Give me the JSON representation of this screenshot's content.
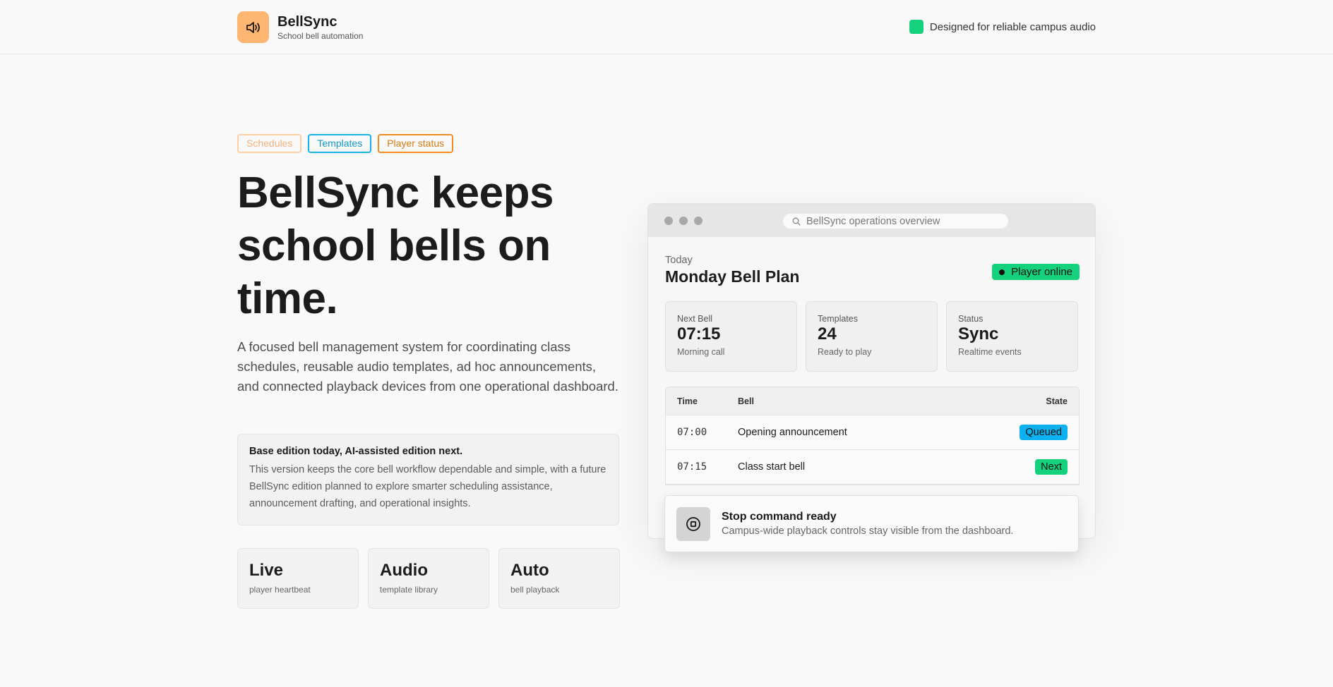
{
  "header": {
    "app_name": "BellSync",
    "app_subtitle": "School bell automation",
    "logo_icon": "speaker-icon",
    "tagline": "Designed for reliable campus audio"
  },
  "chips": [
    "Schedules",
    "Templates",
    "Player status"
  ],
  "hero": {
    "title": "BellSync keeps school bells on time.",
    "description": "A focused bell management system for coordinating class schedules, reusable audio templates, ad hoc announcements, and connected playback devices from one operational dashboard."
  },
  "note": {
    "title": "Base edition today, AI-assisted edition next.",
    "body": "This version keeps the core bell workflow dependable and simple, with a future BellSync edition planned to explore smarter scheduling assistance, announcement drafting, and operational insights."
  },
  "stats": [
    {
      "big": "Live",
      "small": "player heartbeat"
    },
    {
      "big": "Audio",
      "small": "template library"
    },
    {
      "big": "Auto",
      "small": "bell playback"
    }
  ],
  "window": {
    "search_placeholder": "BellSync operations overview",
    "today_label": "Today",
    "plan_title": "Monday Bell Plan",
    "online_badge": "Player online",
    "metrics": [
      {
        "label": "Next Bell",
        "value": "07:15",
        "sub": "Morning call"
      },
      {
        "label": "Templates",
        "value": "24",
        "sub": "Ready to play"
      },
      {
        "label": "Status",
        "value": "Sync",
        "sub": "Realtime events"
      }
    ],
    "table": {
      "headers": {
        "time": "Time",
        "bell": "Bell",
        "state": "State"
      },
      "rows": [
        {
          "time": "07:00",
          "bell": "Opening announcement",
          "state": "Queued"
        },
        {
          "time": "07:15",
          "bell": "Class start bell",
          "state": "Next"
        }
      ]
    },
    "stop_card": {
      "title": "Stop command ready",
      "subtitle": "Campus-wide playback controls stay visible from the dashboard."
    }
  },
  "colors": {
    "accent_orange": "#ffb673",
    "accent_green": "#14d27c",
    "accent_blue": "#0db1ef"
  }
}
